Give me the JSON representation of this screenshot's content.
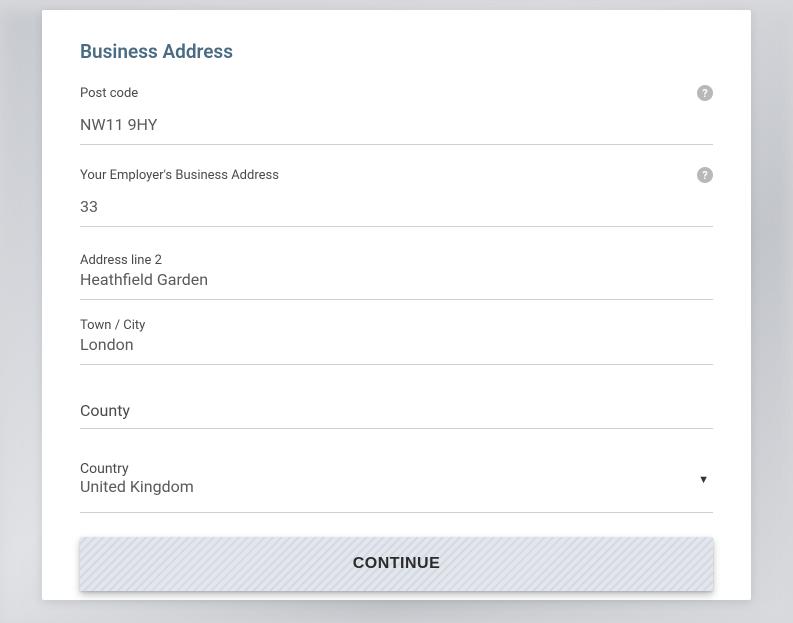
{
  "form": {
    "title": "Business Address",
    "postcode": {
      "label": "Post code",
      "value": "NW11 9HY"
    },
    "address1": {
      "label": "Your Employer's Business Address",
      "value": "33"
    },
    "address2": {
      "label": "Address line 2",
      "value": "Heathfield Garden"
    },
    "town": {
      "label": "Town / City",
      "value": "London"
    },
    "county": {
      "placeholder": "County",
      "value": ""
    },
    "country": {
      "label": "Country",
      "value": "United Kingdom"
    },
    "continue_label": "CONTINUE",
    "help_glyph": "?"
  }
}
